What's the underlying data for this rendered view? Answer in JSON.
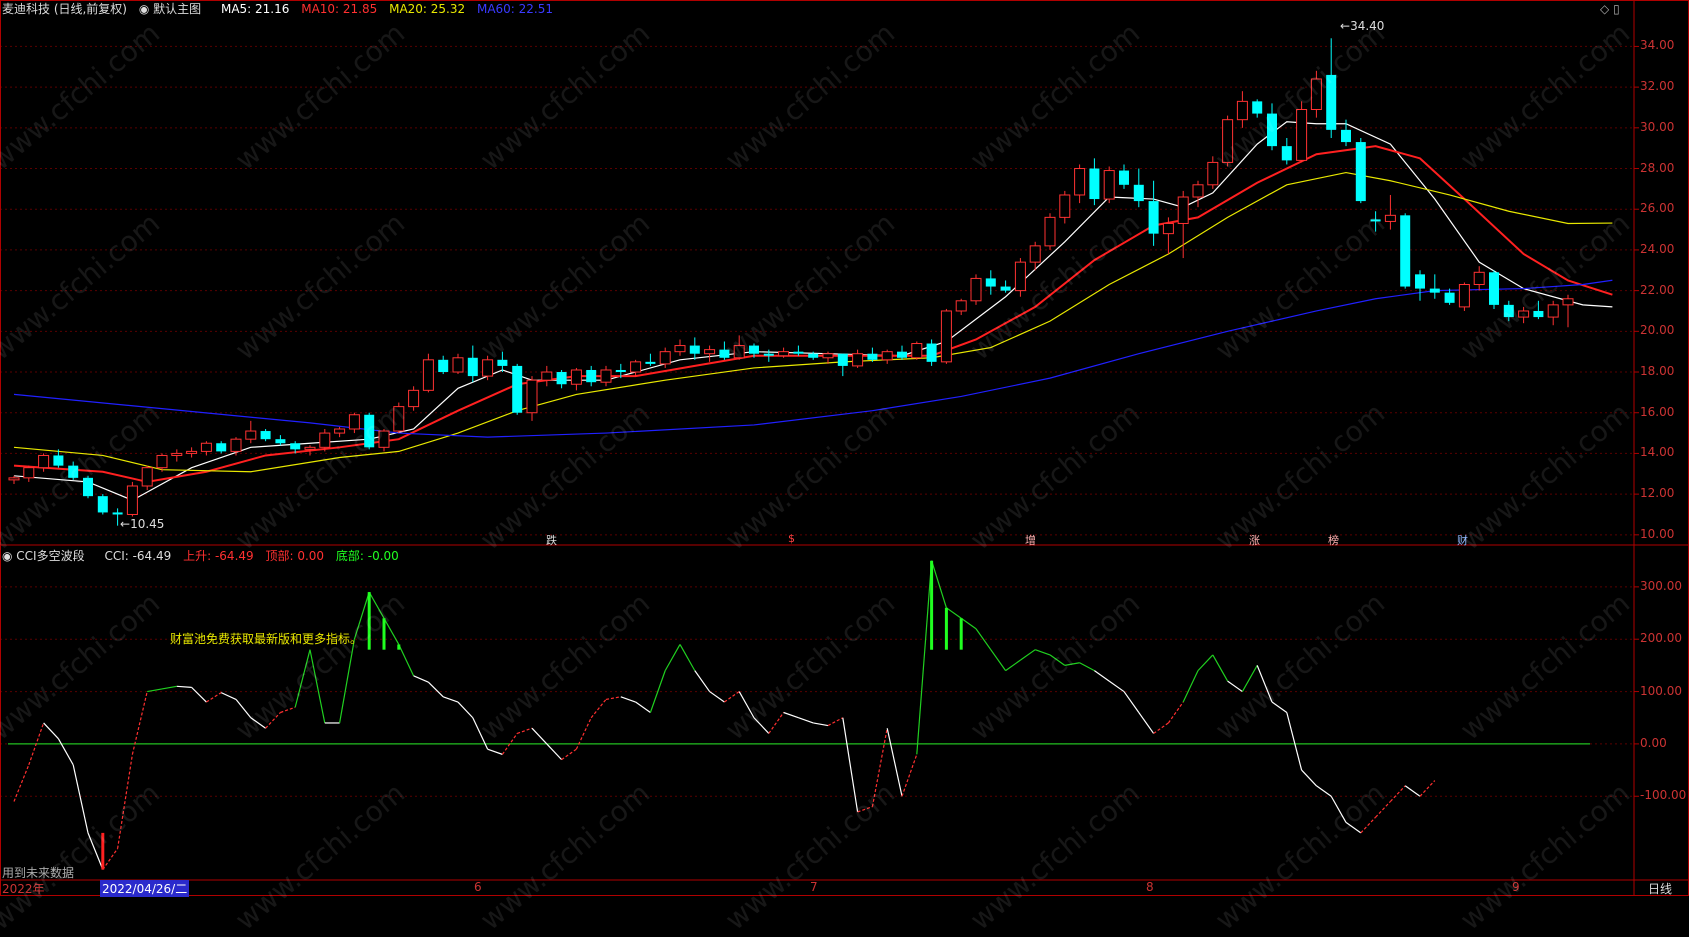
{
  "header": {
    "stock": "麦迪科技 (日线,前复权)",
    "main_chart": "默认主图",
    "ma5": "MA5: 21.16",
    "ma10": "MA10: 21.85",
    "ma20": "MA20: 25.32",
    "ma60": "MA60: 22.51"
  },
  "sub_header": {
    "indicator": "CCI多空波段",
    "cci": "CCI: -64.49",
    "up": "上升: -64.49",
    "top": "顶部: 0.00",
    "bottom": "底部: -0.00"
  },
  "note": "财富池免费获取最新版和更多指标。",
  "future_data": "用到未来数据",
  "period": "日线",
  "x_axis": {
    "year": "2022年",
    "cursor_date": "2022/04/26/二",
    "months": [
      "6",
      "7",
      "8",
      "9"
    ]
  },
  "events": [
    "跌",
    "$",
    "增",
    "涨",
    "榜",
    "财"
  ],
  "price_labels": {
    "high": "34.40",
    "low": "10.45"
  },
  "colors": {
    "up": "#ff3232",
    "down": "#00ffff",
    "ma5": "#ffffff",
    "ma10": "#ff2020",
    "ma20": "#e8e800",
    "ma60": "#2020ff",
    "grid": "#5a0000",
    "frame": "#b00000"
  },
  "chart_data": [
    {
      "type": "candlestick",
      "ylim": [
        9.5,
        35.2
      ],
      "yticks": [
        "10.00",
        "12.00",
        "14.00",
        "16.00",
        "18.00",
        "20.00",
        "22.00",
        "24.00",
        "26.00",
        "28.00",
        "30.00",
        "32.00",
        "34.00"
      ],
      "ohlc": [
        [
          12.7,
          12.9,
          12.5,
          12.8
        ],
        [
          12.8,
          13.4,
          12.6,
          13.3
        ],
        [
          13.3,
          14.0,
          13.1,
          13.9
        ],
        [
          13.9,
          14.2,
          13.3,
          13.4
        ],
        [
          13.4,
          13.6,
          12.7,
          12.8
        ],
        [
          12.8,
          12.9,
          11.8,
          11.9
        ],
        [
          11.9,
          12.0,
          11.0,
          11.1
        ],
        [
          11.1,
          11.3,
          10.45,
          11.0
        ],
        [
          11.0,
          12.6,
          10.9,
          12.4
        ],
        [
          12.4,
          13.4,
          12.2,
          13.3
        ],
        [
          13.3,
          14.0,
          13.1,
          13.9
        ],
        [
          13.9,
          14.2,
          13.6,
          14.0
        ],
        [
          14.0,
          14.3,
          13.8,
          14.1
        ],
        [
          14.1,
          14.6,
          13.9,
          14.5
        ],
        [
          14.5,
          14.6,
          14.0,
          14.1
        ],
        [
          14.1,
          14.8,
          13.9,
          14.7
        ],
        [
          14.7,
          15.6,
          14.5,
          15.1
        ],
        [
          15.1,
          15.2,
          14.6,
          14.7
        ],
        [
          14.7,
          14.9,
          14.4,
          14.5
        ],
        [
          14.5,
          14.6,
          14.0,
          14.2
        ],
        [
          14.2,
          14.4,
          13.9,
          14.3
        ],
        [
          14.3,
          15.2,
          14.1,
          15.0
        ],
        [
          15.0,
          15.3,
          14.8,
          15.2
        ],
        [
          15.2,
          16.0,
          15.0,
          15.9
        ],
        [
          15.9,
          16.0,
          14.2,
          14.3
        ],
        [
          14.3,
          15.2,
          14.1,
          15.1
        ],
        [
          15.1,
          16.5,
          15.0,
          16.3
        ],
        [
          16.3,
          17.3,
          16.1,
          17.1
        ],
        [
          17.1,
          18.9,
          17.0,
          18.6
        ],
        [
          18.6,
          18.8,
          17.9,
          18.0
        ],
        [
          18.0,
          18.9,
          17.9,
          18.7
        ],
        [
          18.7,
          19.3,
          17.5,
          17.8
        ],
        [
          17.8,
          18.8,
          17.6,
          18.6
        ],
        [
          18.6,
          19.0,
          18.0,
          18.3
        ],
        [
          18.3,
          18.4,
          15.9,
          16.0
        ],
        [
          16.0,
          17.8,
          15.6,
          17.6
        ],
        [
          17.6,
          18.3,
          17.3,
          18.0
        ],
        [
          18.0,
          18.1,
          17.2,
          17.4
        ],
        [
          17.4,
          18.2,
          17.1,
          18.1
        ],
        [
          18.1,
          18.3,
          17.3,
          17.5
        ],
        [
          17.5,
          18.3,
          17.3,
          18.1
        ],
        [
          18.1,
          18.4,
          17.7,
          18.0
        ],
        [
          18.0,
          18.6,
          17.8,
          18.5
        ],
        [
          18.5,
          18.9,
          18.3,
          18.4
        ],
        [
          18.4,
          19.2,
          18.2,
          19.0
        ],
        [
          19.0,
          19.6,
          18.8,
          19.3
        ],
        [
          19.3,
          19.7,
          18.6,
          18.9
        ],
        [
          18.9,
          19.3,
          18.5,
          19.1
        ],
        [
          19.1,
          19.5,
          18.6,
          18.7
        ],
        [
          18.7,
          19.8,
          18.6,
          19.3
        ],
        [
          19.3,
          19.4,
          18.7,
          18.9
        ],
        [
          18.9,
          19.1,
          18.5,
          18.8
        ],
        [
          18.8,
          19.2,
          18.7,
          19.0
        ],
        [
          19.0,
          19.3,
          18.8,
          18.9
        ],
        [
          18.9,
          19.0,
          18.6,
          18.7
        ],
        [
          18.7,
          19.0,
          18.4,
          18.9
        ],
        [
          18.9,
          18.9,
          17.8,
          18.3
        ],
        [
          18.3,
          19.1,
          18.2,
          18.9
        ],
        [
          18.9,
          19.2,
          18.5,
          18.6
        ],
        [
          18.6,
          19.1,
          18.4,
          19.0
        ],
        [
          19.0,
          19.3,
          18.6,
          18.7
        ],
        [
          18.7,
          19.5,
          18.6,
          19.4
        ],
        [
          19.4,
          19.6,
          18.3,
          18.5
        ],
        [
          18.5,
          21.1,
          18.4,
          21.0
        ],
        [
          21.0,
          21.6,
          20.8,
          21.5
        ],
        [
          21.5,
          22.8,
          21.3,
          22.6
        ],
        [
          22.6,
          23.0,
          21.8,
          22.2
        ],
        [
          22.2,
          22.5,
          21.9,
          22.0
        ],
        [
          22.0,
          23.6,
          21.7,
          23.4
        ],
        [
          23.4,
          24.4,
          23.0,
          24.2
        ],
        [
          24.2,
          25.8,
          24.0,
          25.6
        ],
        [
          25.6,
          26.9,
          25.3,
          26.7
        ],
        [
          26.7,
          28.2,
          26.3,
          28.0
        ],
        [
          28.0,
          28.5,
          26.2,
          26.5
        ],
        [
          26.5,
          28.1,
          26.3,
          27.9
        ],
        [
          27.9,
          28.2,
          27.0,
          27.2
        ],
        [
          27.2,
          28.0,
          26.1,
          26.4
        ],
        [
          26.4,
          27.4,
          24.2,
          24.8
        ],
        [
          24.8,
          25.6,
          23.8,
          25.3
        ],
        [
          25.3,
          26.9,
          23.6,
          26.6
        ],
        [
          26.6,
          27.4,
          26.1,
          27.2
        ],
        [
          27.2,
          28.6,
          27.0,
          28.3
        ],
        [
          28.3,
          30.6,
          28.1,
          30.4
        ],
        [
          30.4,
          31.8,
          30.0,
          31.3
        ],
        [
          31.3,
          31.4,
          30.5,
          30.7
        ],
        [
          30.7,
          31.2,
          28.9,
          29.1
        ],
        [
          29.1,
          29.5,
          28.2,
          28.4
        ],
        [
          28.4,
          31.3,
          28.3,
          30.9
        ],
        [
          30.9,
          32.8,
          30.5,
          32.4
        ],
        [
          32.6,
          34.4,
          29.5,
          29.9
        ],
        [
          29.9,
          30.4,
          29.1,
          29.3
        ],
        [
          29.3,
          29.5,
          26.3,
          26.4
        ],
        [
          25.5,
          25.9,
          24.9,
          25.4
        ],
        [
          25.4,
          26.7,
          25.0,
          25.7
        ],
        [
          25.7,
          25.8,
          22.1,
          22.2
        ],
        [
          22.8,
          23.0,
          21.5,
          22.1
        ],
        [
          22.1,
          22.8,
          21.6,
          21.9
        ],
        [
          21.9,
          22.1,
          21.3,
          21.4
        ],
        [
          21.2,
          22.4,
          21.0,
          22.3
        ],
        [
          22.3,
          23.2,
          22.0,
          22.9
        ],
        [
          22.9,
          23.0,
          21.1,
          21.3
        ],
        [
          21.3,
          21.5,
          20.5,
          20.7
        ],
        [
          20.7,
          21.2,
          20.4,
          21.0
        ],
        [
          21.0,
          21.5,
          20.6,
          20.7
        ],
        [
          20.7,
          21.5,
          20.3,
          21.3
        ],
        [
          21.3,
          21.8,
          20.2,
          21.6
        ]
      ],
      "ma": {
        "MA5": [
          [
            0,
            12.9
          ],
          [
            5,
            12.6
          ],
          [
            8,
            11.7
          ],
          [
            12,
            13.3
          ],
          [
            16,
            14.3
          ],
          [
            20,
            14.5
          ],
          [
            24,
            14.7
          ],
          [
            27,
            15.2
          ],
          [
            30,
            17.2
          ],
          [
            33,
            18.1
          ],
          [
            35,
            17.6
          ],
          [
            40,
            17.6
          ],
          [
            45,
            18.6
          ],
          [
            50,
            19.0
          ],
          [
            55,
            18.9
          ],
          [
            60,
            18.8
          ],
          [
            63,
            19.5
          ],
          [
            67,
            21.7
          ],
          [
            71,
            24.4
          ],
          [
            74,
            26.6
          ],
          [
            77,
            26.5
          ],
          [
            79,
            26.1
          ],
          [
            81,
            26.8
          ],
          [
            84,
            29.2
          ],
          [
            86,
            30.3
          ],
          [
            88,
            30.2
          ],
          [
            90,
            30.2
          ],
          [
            93,
            29.2
          ],
          [
            96,
            26.5
          ],
          [
            99,
            23.4
          ],
          [
            102,
            22.1
          ],
          [
            106,
            21.3
          ],
          [
            108,
            21.2
          ]
        ],
        "MA10": [
          [
            0,
            13.4
          ],
          [
            6,
            13.1
          ],
          [
            9,
            12.6
          ],
          [
            13,
            13.1
          ],
          [
            17,
            13.9
          ],
          [
            22,
            14.3
          ],
          [
            26,
            14.7
          ],
          [
            30,
            16.1
          ],
          [
            34,
            17.4
          ],
          [
            38,
            17.8
          ],
          [
            42,
            17.8
          ],
          [
            46,
            18.3
          ],
          [
            50,
            18.8
          ],
          [
            56,
            18.8
          ],
          [
            62,
            18.8
          ],
          [
            65,
            19.6
          ],
          [
            69,
            21.2
          ],
          [
            73,
            23.5
          ],
          [
            77,
            25.2
          ],
          [
            80,
            25.6
          ],
          [
            84,
            27.3
          ],
          [
            88,
            28.7
          ],
          [
            92,
            29.1
          ],
          [
            95,
            28.5
          ],
          [
            98,
            26.5
          ],
          [
            102,
            23.8
          ],
          [
            105,
            22.5
          ],
          [
            108,
            21.8
          ]
        ],
        "MA20": [
          [
            0,
            14.3
          ],
          [
            6,
            13.9
          ],
          [
            10,
            13.2
          ],
          [
            16,
            13.1
          ],
          [
            22,
            13.8
          ],
          [
            26,
            14.1
          ],
          [
            30,
            15.0
          ],
          [
            34,
            16.1
          ],
          [
            38,
            16.9
          ],
          [
            44,
            17.6
          ],
          [
            50,
            18.2
          ],
          [
            56,
            18.5
          ],
          [
            62,
            18.7
          ],
          [
            66,
            19.2
          ],
          [
            70,
            20.5
          ],
          [
            74,
            22.3
          ],
          [
            78,
            23.8
          ],
          [
            82,
            25.6
          ],
          [
            86,
            27.2
          ],
          [
            90,
            27.8
          ],
          [
            93,
            27.4
          ],
          [
            97,
            26.7
          ],
          [
            101,
            25.9
          ],
          [
            105,
            25.3
          ],
          [
            108,
            25.32
          ]
        ],
        "MA60": [
          [
            0,
            16.9
          ],
          [
            10,
            16.2
          ],
          [
            20,
            15.5
          ],
          [
            26,
            15.0
          ],
          [
            32,
            14.8
          ],
          [
            40,
            15.0
          ],
          [
            50,
            15.4
          ],
          [
            58,
            16.1
          ],
          [
            64,
            16.8
          ],
          [
            70,
            17.7
          ],
          [
            76,
            18.9
          ],
          [
            82,
            20.0
          ],
          [
            88,
            21.0
          ],
          [
            92,
            21.6
          ],
          [
            96,
            22.0
          ],
          [
            102,
            22.1
          ],
          [
            106,
            22.3
          ],
          [
            108,
            22.51
          ]
        ]
      }
    },
    {
      "type": "line",
      "ylim": [
        -260,
        380
      ],
      "yticks": [
        "300.00",
        "200.00",
        "100.00",
        "0.00",
        "-100.00"
      ],
      "cci": [
        -110,
        -40,
        40,
        10,
        -40,
        -170,
        -240,
        -200,
        -20,
        100,
        105,
        110,
        108,
        80,
        98,
        85,
        50,
        30,
        60,
        70,
        180,
        40,
        40,
        200,
        290,
        240,
        190,
        130,
        118,
        90,
        80,
        50,
        -10,
        -20,
        20,
        30,
        0,
        -30,
        -10,
        50,
        85,
        90,
        80,
        60,
        140,
        190,
        140,
        100,
        80,
        100,
        50,
        20,
        60,
        50,
        40,
        35,
        50,
        -130,
        -120,
        30,
        -100,
        -20,
        350,
        260,
        240,
        220,
        180,
        140,
        160,
        180,
        170,
        150,
        155,
        140,
        120,
        100,
        60,
        20,
        40,
        80,
        140,
        170,
        120,
        100,
        150,
        80,
        60,
        -50,
        -80,
        -100,
        -150,
        -170,
        -140,
        -110,
        -80,
        -100,
        -70
      ]
    }
  ]
}
